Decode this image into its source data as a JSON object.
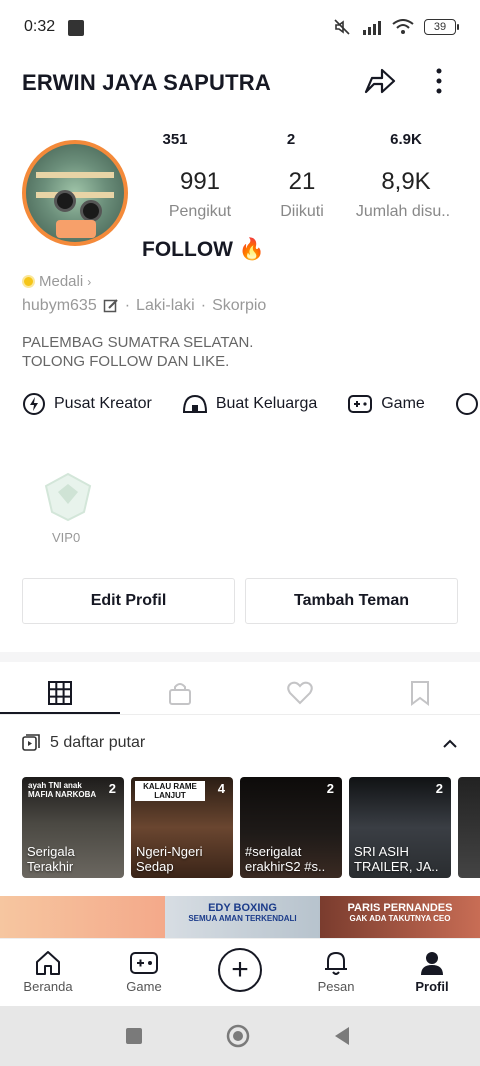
{
  "status_bar": {
    "time": "0:32",
    "battery": "39"
  },
  "profile": {
    "username": "ERWIN JAYA SAPUTRA",
    "follow_banner": "FOLLOW 🔥",
    "stats": [
      {
        "small": "351",
        "big": "991",
        "label": "Pengikut"
      },
      {
        "small": "2",
        "big": "21",
        "label": "Diikuti"
      },
      {
        "small": "6.9K",
        "big": "8,9K",
        "label": "Jumlah disu.."
      }
    ],
    "medal": "Medali",
    "handle": "hubym635",
    "gender": "Laki-laki",
    "zodiac": "Skorpio",
    "bio_line1": "PALEMBAG SUMATRA SELATAN.",
    "bio_line2": "TOLONG FOLLOW DAN LIKE."
  },
  "creator_tools": [
    {
      "label": "Pusat Kreator",
      "icon": "lightning-icon"
    },
    {
      "label": "Buat Keluarga",
      "icon": "house-icon"
    },
    {
      "label": "Game",
      "icon": "gamepad-icon"
    }
  ],
  "vip": {
    "label": "VIP0"
  },
  "buttons": {
    "edit": "Edit Profil",
    "add_friend": "Tambah Teman"
  },
  "tabs": [
    {
      "name": "videos",
      "icon": "grid-icon",
      "active": true
    },
    {
      "name": "private",
      "icon": "lock-icon",
      "active": false
    },
    {
      "name": "liked",
      "icon": "heart-icon",
      "active": false
    },
    {
      "name": "saved",
      "icon": "bookmark-icon",
      "active": false
    }
  ],
  "playlists": {
    "header": "5 daftar putar",
    "items": [
      {
        "title": "Serigala Terakhir",
        "count": "2",
        "top": "ayah TNI anak MAFIA NARKOBA",
        "color": "#3d3a36"
      },
      {
        "title": "Ngeri-Ngeri Sedap",
        "count": "4",
        "top": "KALAU RAME LANJUT",
        "color": "#5a3d2a"
      },
      {
        "title": "#serigalat erakhirS2 #s..",
        "count": "2",
        "top": "",
        "color": "#1e1a18"
      },
      {
        "title": "SRI ASIH TRAILER, JA..",
        "count": "2",
        "top": "",
        "color": "#2a2e33"
      }
    ]
  },
  "banner": {
    "mid_title": "EDY BOXING",
    "mid_sub": "SEMUA AMAN TERKENDALI",
    "right_title": "PARIS PERNANDES",
    "right_sub": "GAK ADA TAKUTNYA CEO"
  },
  "nav": {
    "home": "Beranda",
    "game": "Game",
    "plus": "+",
    "inbox": "Pesan",
    "profile": "Profil"
  },
  "colors": {
    "avatar_ring": "#f48a3a",
    "text": "#161823",
    "muted": "#888888"
  }
}
